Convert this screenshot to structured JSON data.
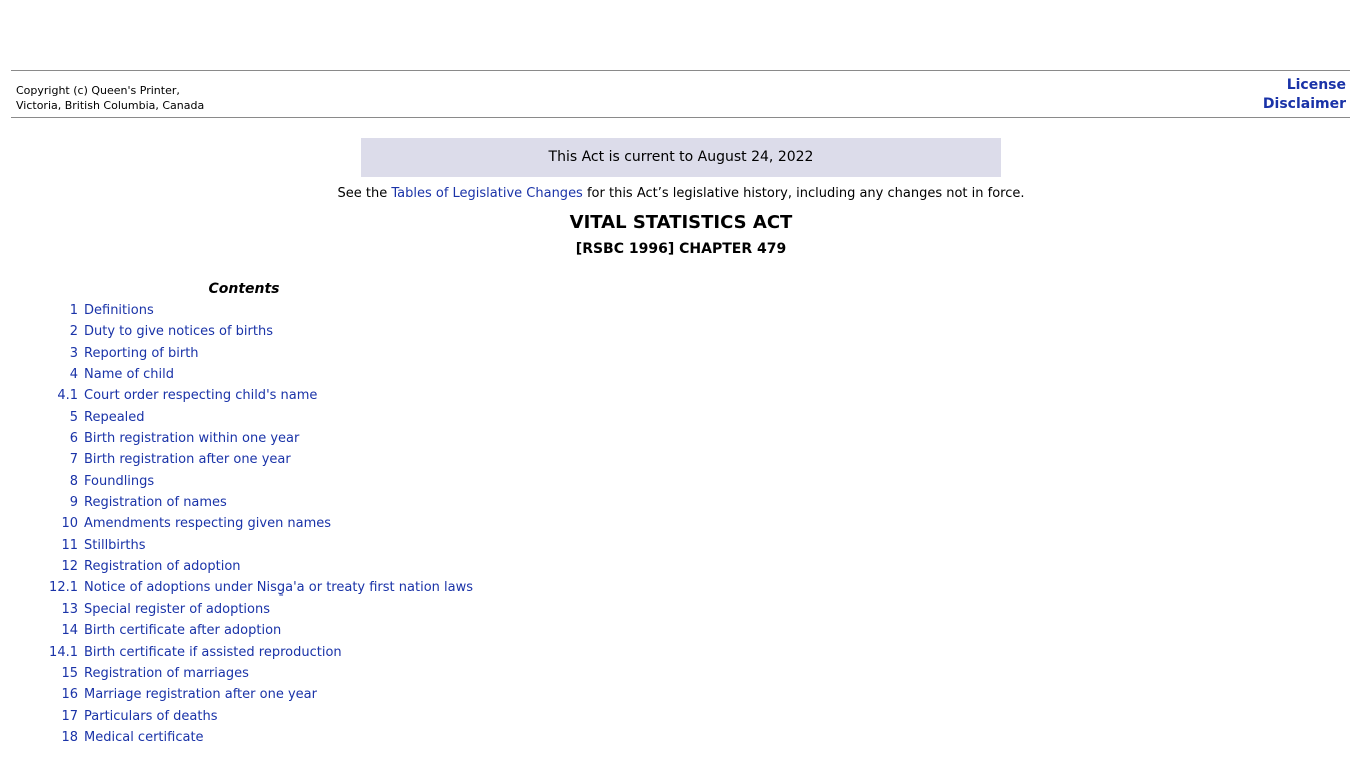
{
  "header": {
    "copyright_line1": "Copyright (c) Queen's Printer,",
    "copyright_line2": "Victoria, British Columbia, Canada",
    "license_label": "License",
    "disclaimer_label": "Disclaimer"
  },
  "banner": {
    "current_text": "This Act is current to August 24, 2022"
  },
  "legislative_note": {
    "prefix": "See the ",
    "link_text": "Tables of Legislative Changes",
    "suffix": " for this Act’s legislative history, including any changes not in force."
  },
  "act": {
    "title": "VITAL STATISTICS ACT",
    "chapter": "[RSBC 1996] CHAPTER 479"
  },
  "contents": {
    "heading": "Contents",
    "items": [
      {
        "num": "1",
        "title": "Definitions"
      },
      {
        "num": "2",
        "title": "Duty to give notices of births"
      },
      {
        "num": "3",
        "title": "Reporting of birth"
      },
      {
        "num": "4",
        "title": "Name of child"
      },
      {
        "num": "4.1",
        "title": "Court order respecting child's name"
      },
      {
        "num": "5",
        "title": "Repealed"
      },
      {
        "num": "6",
        "title": "Birth registration within one year"
      },
      {
        "num": "7",
        "title": "Birth registration after one year"
      },
      {
        "num": "8",
        "title": "Foundlings"
      },
      {
        "num": "9",
        "title": "Registration of names"
      },
      {
        "num": "10",
        "title": "Amendments respecting given names"
      },
      {
        "num": "11",
        "title": "Stillbirths"
      },
      {
        "num": "12",
        "title": "Registration of adoption"
      },
      {
        "num": "12.1",
        "title": "Notice of adoptions under Nisg̱a'a or treaty first nation laws"
      },
      {
        "num": "13",
        "title": "Special register of adoptions"
      },
      {
        "num": "14",
        "title": "Birth certificate after adoption"
      },
      {
        "num": "14.1",
        "title": "Birth certificate if assisted reproduction"
      },
      {
        "num": "15",
        "title": "Registration of marriages"
      },
      {
        "num": "16",
        "title": "Marriage registration after one year"
      },
      {
        "num": "17",
        "title": "Particulars of deaths"
      },
      {
        "num": "18",
        "title": "Medical certificate"
      }
    ]
  }
}
